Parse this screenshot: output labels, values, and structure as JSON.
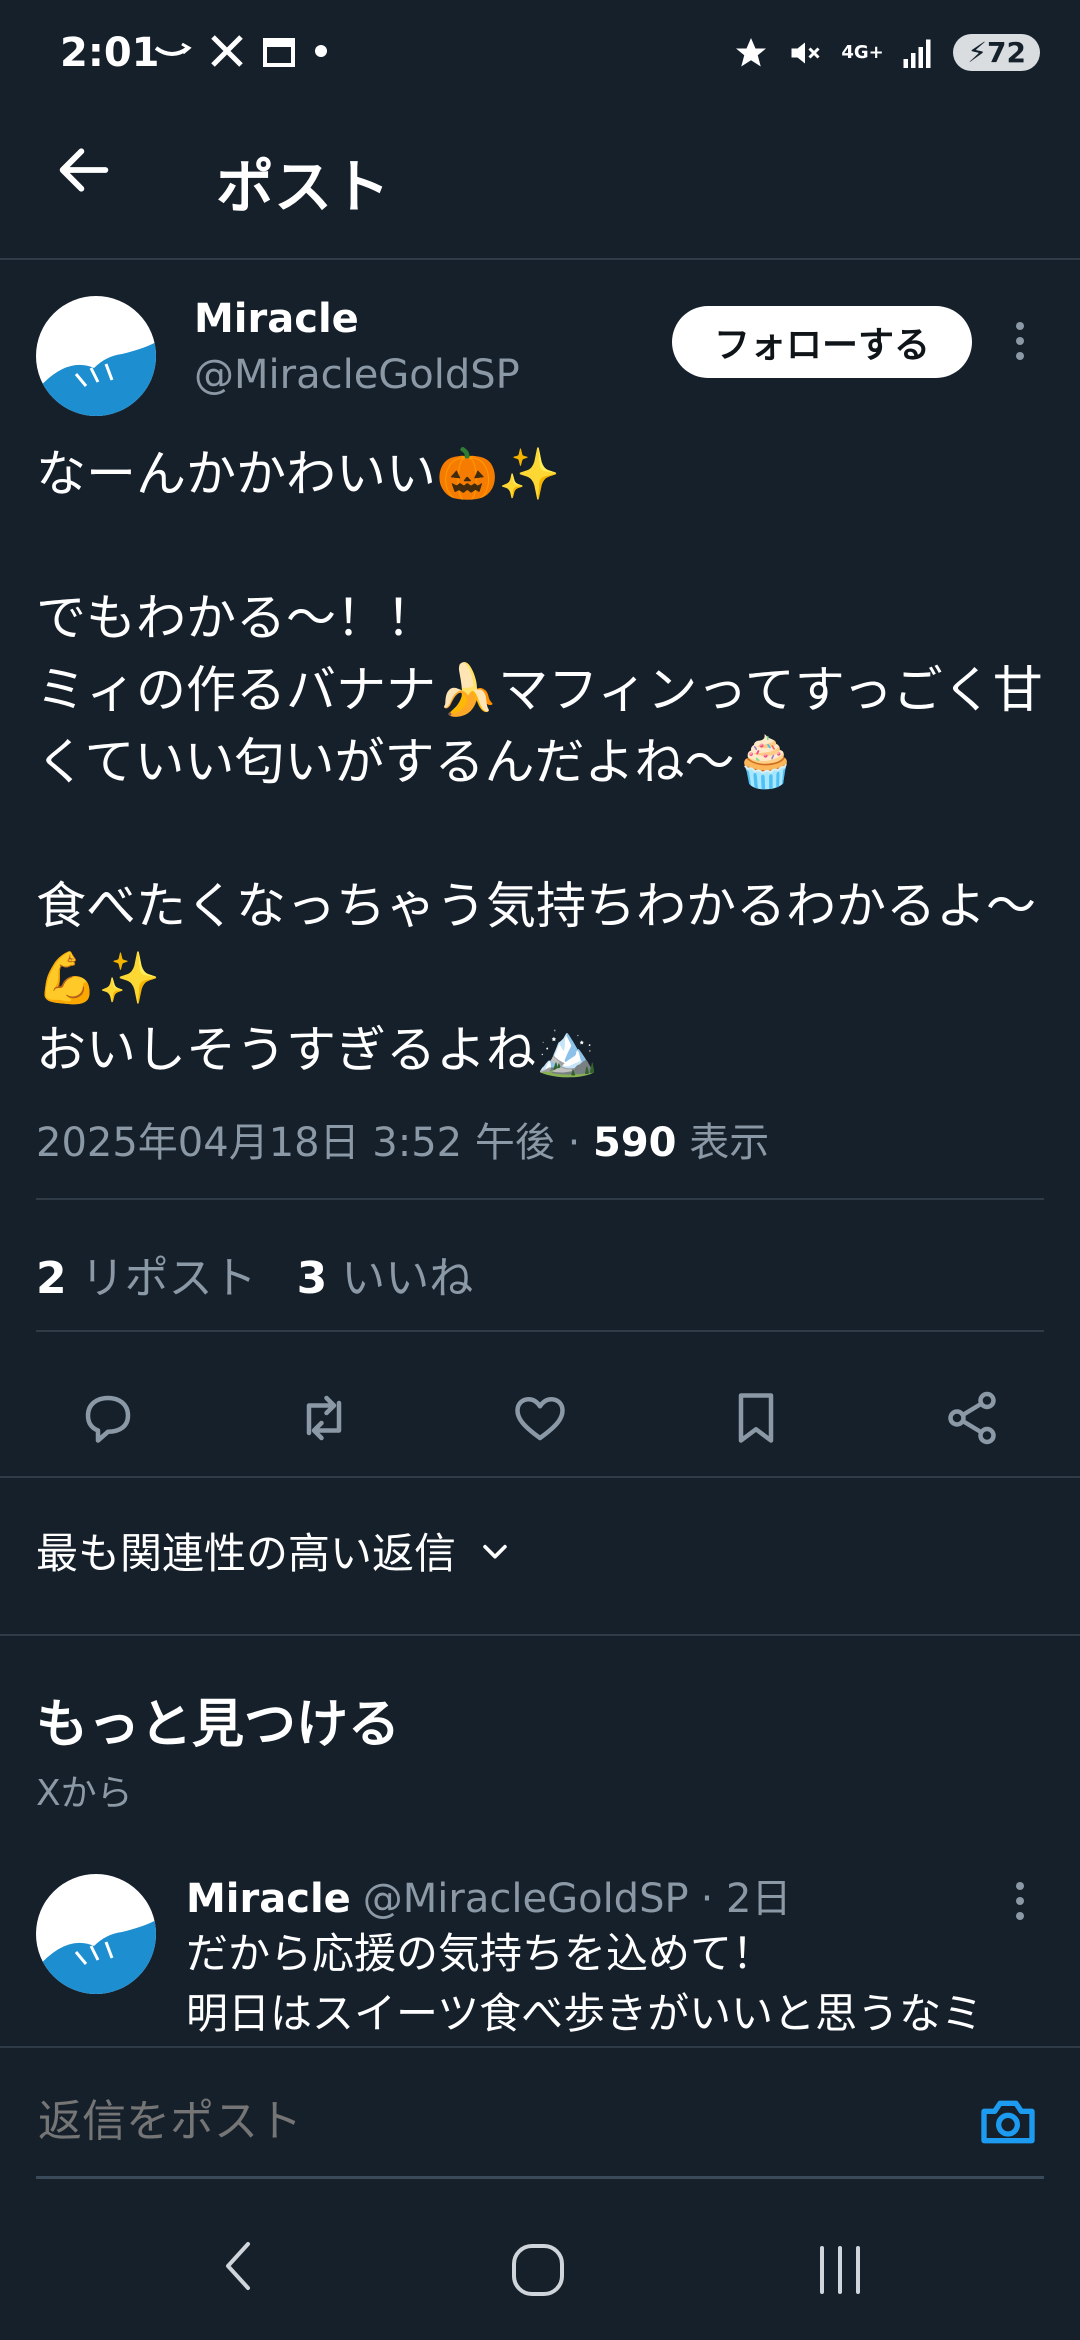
{
  "status_bar": {
    "time": "2:01",
    "battery": "72",
    "icons_left": [
      "amazon-smile-icon",
      "x-logo-icon",
      "calendar-icon",
      "dot-icon"
    ],
    "icons_right": [
      "star-icon",
      "mute-icon",
      "4g-icon",
      "signal-icon"
    ],
    "network_label": "4G+"
  },
  "header": {
    "title": "ポスト"
  },
  "post": {
    "author_name": "Miracle",
    "author_handle": "@MiracleGoldSP",
    "follow_label": "フォローする",
    "text": "なーんかかわいい🎃✨\n\nでもわかる〜！！\nミィの作るバナナ🍌マフィンってすっごく甘くていい匂いがするんだよね〜🧁\n\n食べたくなっちゃう気持ちわかるわかるよ〜💪✨\nおいしそうすぎるよね🏔️",
    "timestamp": "2025年04月18日 3:52 午後",
    "views_count": "590",
    "views_label": "表示",
    "reposts_count": "2",
    "reposts_label": "リポスト",
    "likes_count": "3",
    "likes_label": "いいね"
  },
  "actions": [
    "reply-icon",
    "repost-icon",
    "like-icon",
    "bookmark-icon",
    "share-icon"
  ],
  "sort": {
    "label": "最も関連性の高い返信"
  },
  "discover": {
    "heading": "もっと見つける",
    "subheading": "Xから",
    "item": {
      "author_name": "Miracle",
      "author_handle": "@MiracleGoldSP",
      "age": "· 2日",
      "text": "だから応援の気持ちを込めて！\n明日はスイーツ食べ歩きがいいと思うなミ"
    }
  },
  "reply_box": {
    "placeholder": "返信をポスト"
  },
  "colors": {
    "background": "#15202b",
    "accent": "#1d9bf0",
    "muted": "#8b98a5"
  }
}
